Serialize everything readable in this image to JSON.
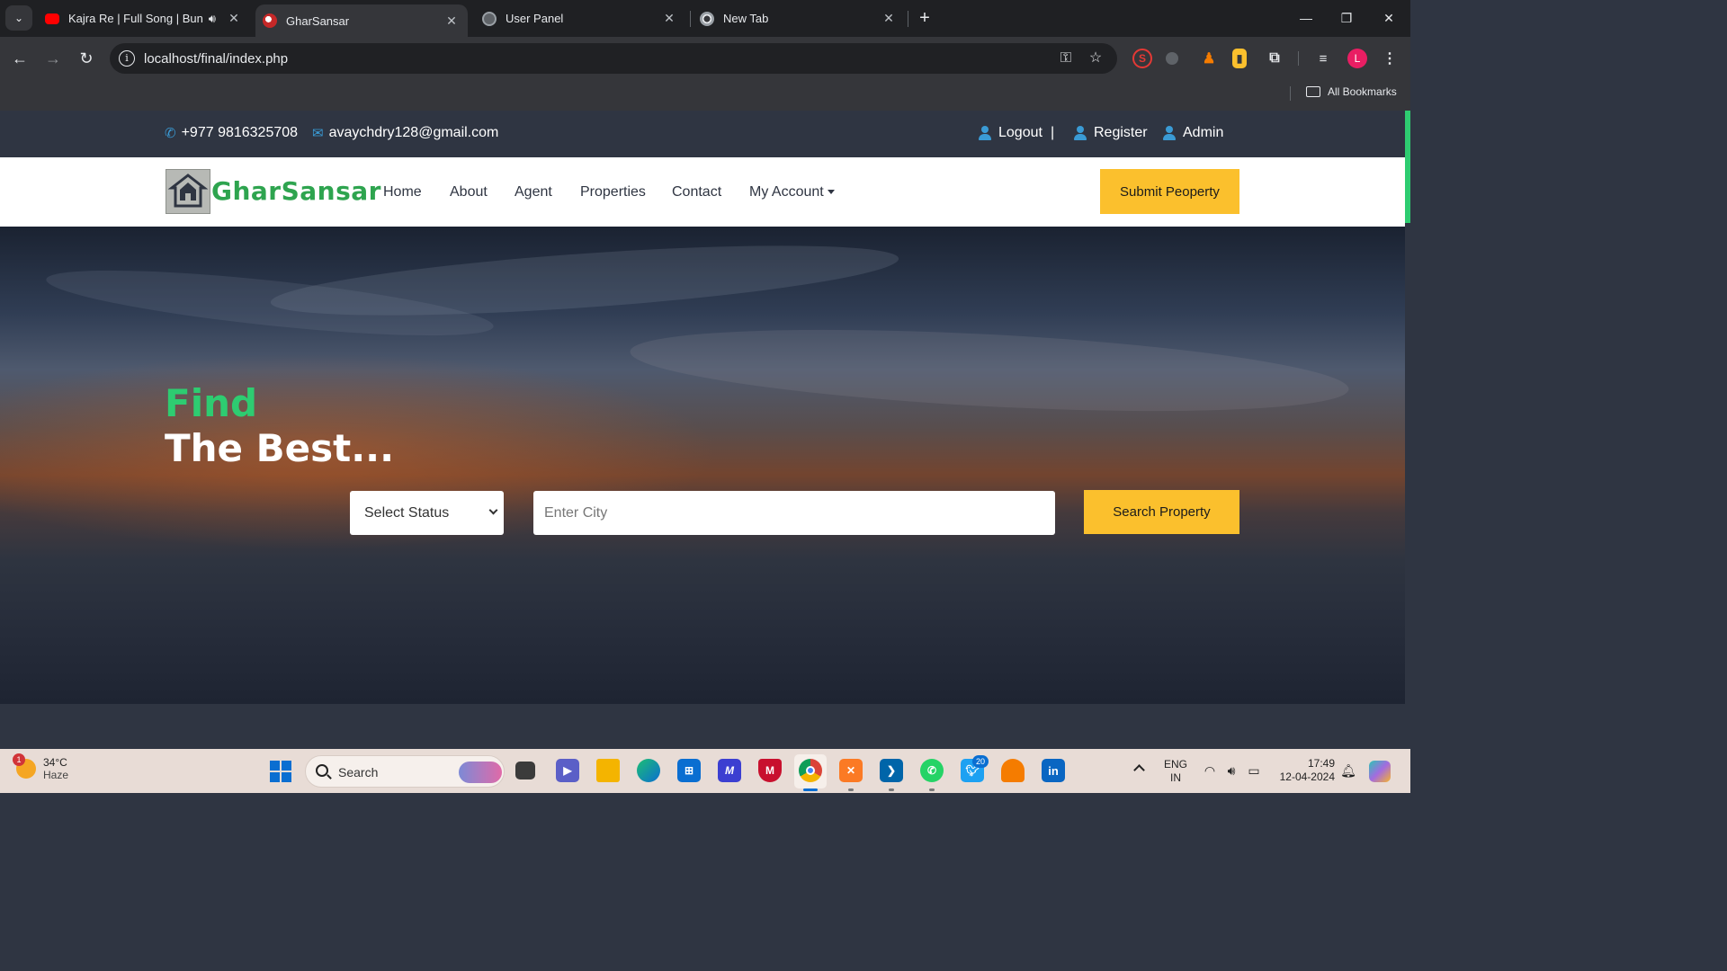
{
  "browser": {
    "tabs": [
      {
        "title": "Kajra Re | Full Song | Bunty",
        "favicon": "youtube-icon",
        "audio": true,
        "active": false
      },
      {
        "title": "GharSansar",
        "favicon": "ghar-sansar-icon",
        "active": true
      },
      {
        "title": "User Panel",
        "favicon": "globe-icon",
        "active": false
      },
      {
        "title": "New Tab",
        "favicon": "chrome-icon",
        "active": false
      }
    ],
    "url": "localhost/final/index.php",
    "bookmarks_label": "All Bookmarks",
    "profile_initial": "L",
    "colors": {
      "tabstrip": "#1f2023",
      "toolbar": "#35363a",
      "omnibox": "#202124"
    }
  },
  "site": {
    "topbar": {
      "phone": "+977 9816325708",
      "email": "avaychdry128@gmail.com",
      "logout": "Logout",
      "separator": "|",
      "register": "Register",
      "admin": "Admin"
    },
    "brand": "GharSansar",
    "nav": {
      "home": "Home",
      "about": "About",
      "agent": "Agent",
      "properties": "Properties",
      "contact": "Contact",
      "my_account": "My Account"
    },
    "submit_button": "Submit Peoperty",
    "hero": {
      "line1": "Find",
      "line2": "The Best..."
    },
    "search": {
      "status_selected": "Select Status",
      "city_placeholder": "Enter City",
      "button": "Search Property"
    },
    "colors": {
      "accent_yellow": "#fbc02d",
      "brand_green": "#2ea44f",
      "dark": "#2f3542",
      "icon_blue": "#3a9bd5"
    }
  },
  "taskbar": {
    "weather": {
      "temp": "34°C",
      "condition": "Haze",
      "badge": "1"
    },
    "search_label": "Search",
    "twitter_badge": "20",
    "lang": {
      "line1": "ENG",
      "line2": "IN"
    },
    "time": "17:49",
    "date": "12-04-2024"
  }
}
